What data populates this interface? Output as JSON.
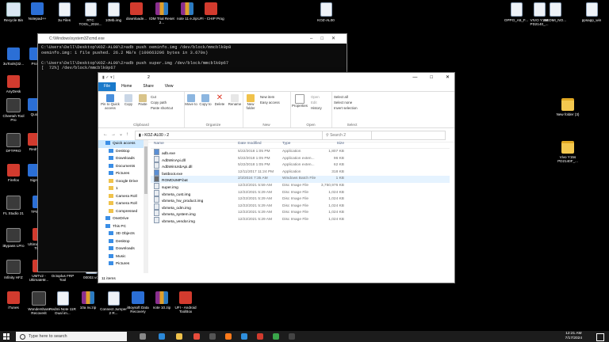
{
  "desktop": {
    "icons": [
      {
        "label": "Recycle Bin",
        "kind": "rec"
      },
      {
        "label": "Notepad++",
        "kind": "app"
      },
      {
        "label": "3u Files",
        "kind": "file"
      },
      {
        "label": "RTC TOOL_2024...",
        "kind": "file"
      },
      {
        "label": "10Mb.img",
        "kind": "file"
      },
      {
        "label": "downloade...",
        "kind": "red"
      },
      {
        "label": "IDM Trial Reset 2...",
        "kind": "rar"
      },
      {
        "label": "note 11 e.zip",
        "kind": "rar"
      },
      {
        "label": "UFI - CHIP Prog",
        "kind": "red"
      },
      {
        "label": "KOZ-AL00",
        "kind": "file"
      },
      {
        "label": "VIVO Y15s PD2140_...",
        "kind": "file"
      },
      {
        "label": "OPPO_A5_F...",
        "kind": "file"
      },
      {
        "label": "REDMI_NO...",
        "kind": "file"
      },
      {
        "label": "ppsapp_win",
        "kind": "file"
      },
      {
        "label": "3uTools(32...",
        "kind": "app"
      },
      {
        "label": "Proto",
        "kind": "app"
      },
      {
        "label": "AnyDesk",
        "kind": "red"
      },
      {
        "label": "Cheetah Tool Pro",
        "kind": "dark"
      },
      {
        "label": "Quo",
        "kind": "app"
      },
      {
        "label": "DFTPRO",
        "kind": "dark"
      },
      {
        "label": "Redm",
        "kind": "red"
      },
      {
        "label": "Firefox",
        "kind": "red"
      },
      {
        "label": "Sigm",
        "kind": "app"
      },
      {
        "label": "FL Studio 21",
        "kind": "dark"
      },
      {
        "label": "TPS_Tool",
        "kind": "app"
      },
      {
        "label": "Minimal ADB and Fastboot",
        "kind": "folder"
      },
      {
        "label": "SPT_OTA_[I...",
        "kind": "folder"
      },
      {
        "label": "iBypass LPro",
        "kind": "dark"
      },
      {
        "label": "Ultimate Multi Too...",
        "kind": "red"
      },
      {
        "label": "New folder (2)",
        "kind": "folder"
      },
      {
        "label": "ZeroKnox Removal",
        "kind": "folder"
      },
      {
        "label": "Infinity HFZ",
        "kind": "dark"
      },
      {
        "label": "UMTv2 - UltimateM...",
        "kind": "red"
      },
      {
        "label": "Octoplus FRP Tool",
        "kind": "green"
      },
      {
        "label": "00002.vcf",
        "kind": "file"
      },
      {
        "label": "iTunes",
        "kind": "red"
      },
      {
        "label": "Wondershare Recoverit",
        "kind": "dark"
      },
      {
        "label": "Redmi Note 11R Dual im...",
        "kind": "file"
      },
      {
        "label": "10a nv.zip",
        "kind": "rar"
      },
      {
        "label": "Connect Jumper 2 R...",
        "kind": "file"
      },
      {
        "label": "iBoysoft Data Recovery",
        "kind": "app"
      },
      {
        "label": "note 10.zip",
        "kind": "rar"
      },
      {
        "label": "UFI - Android ToolBox",
        "kind": "red"
      },
      {
        "label": "New folder (3)",
        "kind": "folder"
      },
      {
        "label": "Vivo Y15s PD2140F_...",
        "kind": "folder"
      }
    ]
  },
  "cmd": {
    "title": "C:\\Windows\\system32\\cmd.exe",
    "lines": [
      "C:\\Users\\Dell\\Desktop\\KOZ-AL00\\2>adb push oeminfo.img /dev/block/mmcblk0p8",
      "oeminfo.img: 1 file pushed. 26.2 MB/s (100663296 bytes in 3.670s)",
      "",
      "C:\\Users\\Dell\\Desktop\\KOZ-AL00\\2>adb push super.img /dev/block/mmcblk0p67",
      "[  72%] /dev/block/mmcblk0p67"
    ]
  },
  "explorer": {
    "title": "2",
    "tabs": [
      "File",
      "Home",
      "Share",
      "View"
    ],
    "ribbon": {
      "clipboard": {
        "label": "Clipboard",
        "pin": "Pin to Quick access",
        "copy": "Copy",
        "paste": "Paste",
        "cut": "Cut",
        "copy_path": "Copy path",
        "paste_shortcut": "Paste shortcut"
      },
      "organize": {
        "label": "Organize",
        "move": "Move to",
        "copy": "Copy to",
        "delete": "Delete",
        "rename": "Rename"
      },
      "new": {
        "label": "New",
        "folder": "New folder",
        "item": "New item",
        "easy": "Easy access"
      },
      "open": {
        "label": "Open",
        "properties": "Properties",
        "open": "Open",
        "edit": "Edit",
        "history": "History"
      },
      "select": {
        "label": "Select",
        "all": "Select all",
        "none": "Select none",
        "invert": "Invert selection"
      }
    },
    "path": [
      "KOZ-AL00",
      "2"
    ],
    "search_placeholder": "Search 2",
    "nav": [
      {
        "label": "Quick access",
        "sel": true,
        "icon": "b"
      },
      {
        "label": "Desktop",
        "icon": "b"
      },
      {
        "label": "Downloads",
        "icon": "b"
      },
      {
        "label": "Documents",
        "icon": "b"
      },
      {
        "label": "Pictures",
        "icon": "b"
      },
      {
        "label": "Google Drive",
        "icon": "y"
      },
      {
        "label": "1",
        "icon": "y"
      },
      {
        "label": "Camera Roll",
        "icon": "y"
      },
      {
        "label": "Camera Roll",
        "icon": "y"
      },
      {
        "label": "Compressed",
        "icon": "y"
      },
      {
        "label": "OneDrive",
        "icon": "b"
      },
      {
        "label": "This PC",
        "icon": "b"
      },
      {
        "label": "3D Objects",
        "icon": "b"
      },
      {
        "label": "Desktop",
        "icon": "b"
      },
      {
        "label": "Downloads",
        "icon": "b"
      },
      {
        "label": "Music",
        "icon": "b"
      },
      {
        "label": "Pictures",
        "icon": "b"
      }
    ],
    "columns": {
      "name": "Name",
      "date": "Date modified",
      "type": "Type",
      "size": "Size"
    },
    "files": [
      {
        "name": "adb.exe",
        "date": "5/22/2018 1:05 PM",
        "type": "Application",
        "size": "1,807 KB",
        "icon": "exe"
      },
      {
        "name": "AdbWinApi.dll",
        "date": "5/22/2018 1:05 PM",
        "type": "Application exten...",
        "size": "96 KB",
        "icon": "file"
      },
      {
        "name": "AdbWinUsbApi.dll",
        "date": "5/22/2018 1:05 PM",
        "type": "Application exten...",
        "size": "62 KB",
        "icon": "file"
      },
      {
        "name": "fastboot.exe",
        "date": "12/11/2017 11:24 PM",
        "type": "Application",
        "size": "318 KB",
        "icon": "exe"
      },
      {
        "name": "ROMDUMP.bat",
        "date": "2/3/2024 7:35 AM",
        "type": "Windows Batch File",
        "size": "1 KB",
        "icon": "bat",
        "sel": true
      },
      {
        "name": "super.img",
        "date": "12/22/2021 5:59 AM",
        "type": "Disc Image File",
        "size": "3,750,976 KB",
        "icon": "file"
      },
      {
        "name": "vbmeta_cust.img",
        "date": "12/22/2021 5:29 AM",
        "type": "Disc Image File",
        "size": "1,024 KB",
        "icon": "file"
      },
      {
        "name": "vbmeta_hw_product.img",
        "date": "12/22/2021 5:29 AM",
        "type": "Disc Image File",
        "size": "1,024 KB",
        "icon": "file"
      },
      {
        "name": "vbmeta_odm.img",
        "date": "12/22/2021 5:29 AM",
        "type": "Disc Image File",
        "size": "1,024 KB",
        "icon": "file"
      },
      {
        "name": "vbmeta_system.img",
        "date": "12/22/2021 5:29 AM",
        "type": "Disc Image File",
        "size": "1,024 KB",
        "icon": "file"
      },
      {
        "name": "vbmeta_vendor.img",
        "date": "12/22/2021 5:29 AM",
        "type": "Disc Image File",
        "size": "1,024 KB",
        "icon": "file"
      }
    ],
    "status": "11 items"
  },
  "taskbar": {
    "search_placeholder": "Type here to search",
    "time": "12:21 AM",
    "date": "7/17/2024"
  }
}
